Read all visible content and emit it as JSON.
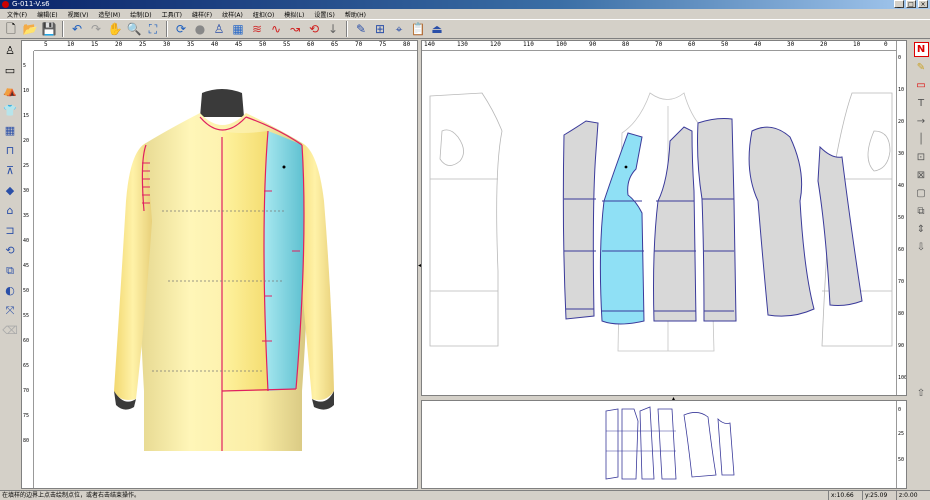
{
  "window": {
    "title": "G-011-V.s6",
    "controls": [
      "_",
      "□",
      "×"
    ]
  },
  "menu": [
    "文件(F)",
    "编辑(E)",
    "视图(V)",
    "造型(M)",
    "绘制(D)",
    "工具(T)",
    "缝样(F)",
    "纹样(A)",
    "纽扣(O)",
    "模拟(L)",
    "设置(S)",
    "帮助(H)"
  ],
  "toolbar_icons": [
    "new-file-icon",
    "open-folder-icon",
    "save-icon",
    "undo-icon",
    "redo-icon",
    "pan-hand-icon",
    "zoom-icon",
    "fit-view-icon",
    "rotate-icon",
    "shading-sphere-icon",
    "figure-icon",
    "texture-icon",
    "color-layers-icon",
    "curve-tool-icon",
    "point-curve-icon",
    "edit-curve-icon",
    "cursor-icon",
    "measure-icon",
    "grid-icon",
    "notch-icon",
    "export-icon",
    "dress-icon"
  ],
  "left_tools": [
    "mannequin-icon",
    "select-rect-icon",
    "cloak-icon",
    "shirt-icon",
    "grid-pattern-icon",
    "pants-icon",
    "dress-shape-icon",
    "gem-icon",
    "jacket-icon",
    "sleeve-icon",
    "rotate-tool-icon",
    "layers-tool-icon",
    "sphere-tool-icon",
    "transform-icon",
    "eraser-icon"
  ],
  "right_tools": [
    "n-tool-icon",
    "note-icon",
    "rectangle-icon",
    "text-t-icon",
    "arrow-right-icon",
    "vertical-line-icon",
    "ruler-square-icon",
    "box-icon",
    "blank-icon",
    "copy-icon",
    "move-icon",
    "down-arrow-icon",
    "up-arrow-icon"
  ],
  "pattern_ruler": {
    "h_labels": [
      "140",
      "130",
      "120",
      "110",
      "100",
      "90",
      "80",
      "70",
      "60",
      "50",
      "40",
      "30",
      "20",
      "10",
      "0"
    ],
    "v_labels": [
      "0",
      "10",
      "20",
      "30",
      "40",
      "50",
      "60",
      "70",
      "80",
      "90",
      "100"
    ]
  },
  "view3d_ruler": {
    "h_labels": [
      "5",
      "10",
      "15",
      "20",
      "25",
      "30",
      "35",
      "40",
      "45",
      "50",
      "55",
      "60",
      "65",
      "70",
      "75",
      "80"
    ],
    "v_labels": [
      "5",
      "10",
      "15",
      "20",
      "25",
      "30",
      "35",
      "40",
      "45",
      "50",
      "55",
      "60",
      "65",
      "70",
      "75",
      "80"
    ]
  },
  "mini_ruler": {
    "v_labels": [
      "0",
      "25",
      "50"
    ]
  },
  "status": {
    "hint": "在填样的边界上点击绘制点位，或者右击结束操作。",
    "x": "x:10.66",
    "y": "y:25.09",
    "z": "z:0.00"
  },
  "colors": {
    "body_fill": "#f8eb9a",
    "selected_panel": "#8fe0f5",
    "pattern_fill": "#d8d8d8",
    "outline_blue": "#3a3aa8",
    "seam_red": "#e02060"
  }
}
